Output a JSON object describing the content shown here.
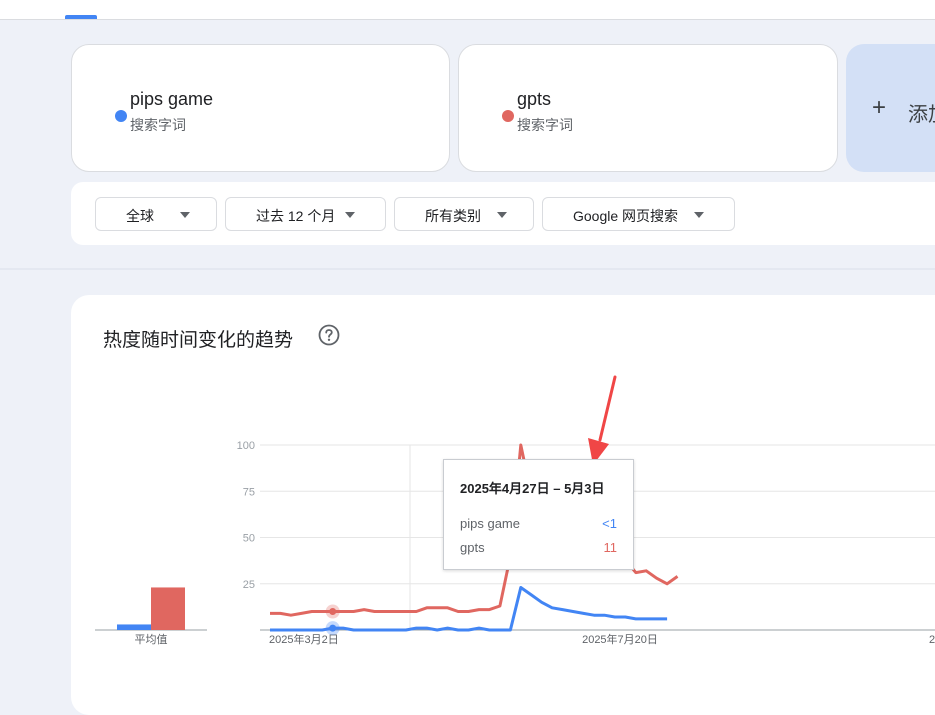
{
  "terms": [
    {
      "name": "pips game",
      "type": "搜索字词",
      "color": "#4285f4"
    },
    {
      "name": "gpts",
      "type": "搜索字词",
      "color": "#e06760"
    }
  ],
  "add_term": {
    "plus": "+",
    "label": "添加"
  },
  "filters": {
    "region": "全球",
    "time": "过去 12 个月",
    "category": "所有类别",
    "property": "Google 网页搜索"
  },
  "chart_section": {
    "title": "热度随时间变化的趋势"
  },
  "chart_data": {
    "type": "line",
    "y_ticks": [
      "100",
      "75",
      "50",
      "25"
    ],
    "ylim": [
      0,
      100
    ],
    "x_tick_labels": [
      "2025年3月2日",
      "2025年7月20日"
    ],
    "average_label": "平均值",
    "averages": [
      {
        "name": "pips game",
        "value": 3
      },
      {
        "name": "gpts",
        "value": 23
      }
    ],
    "series": [
      {
        "name": "pips game",
        "color": "#4285f4",
        "values": [
          0,
          0,
          0,
          0,
          0,
          0,
          1,
          1,
          0,
          0,
          0,
          0,
          0,
          0,
          1,
          1,
          0,
          1,
          0,
          0,
          1,
          0,
          0,
          0,
          23,
          19,
          15,
          12,
          11,
          10,
          9,
          8,
          8,
          7,
          7,
          6,
          6,
          6,
          6
        ]
      },
      {
        "name": "gpts",
        "color": "#e06760",
        "values": [
          9,
          9,
          8,
          9,
          10,
          10,
          10,
          10,
          10,
          11,
          10,
          10,
          10,
          10,
          10,
          12,
          12,
          12,
          10,
          10,
          11,
          11,
          13,
          40,
          100,
          73,
          47,
          47,
          47,
          38,
          34,
          35,
          36,
          37,
          38,
          31,
          32,
          28,
          25,
          29
        ]
      }
    ],
    "highlight": {
      "index": 6,
      "date": "2025年4月27日 – 5月3日",
      "pips game": "<1",
      "gpts": "11"
    }
  }
}
